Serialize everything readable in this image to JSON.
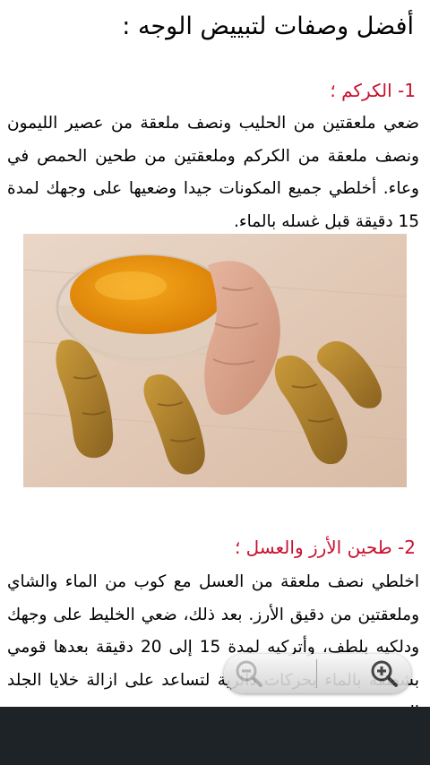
{
  "article": {
    "title": "أفضل وصفات لتبييض الوجه :",
    "recipes": [
      {
        "heading": "1- الكركم ؛",
        "body": "ضعي ملعقتين من الحليب ونصف ملعقة من عصير الليمون ونصف ملعقة من الكركم وملعقتين من طحين الحمص في وعاء. أخلطي جميع المكونات جيدا وضعيها على وجهك لمدة 15 دقيقة قبل غسله بالماء."
      },
      {
        "heading": "2- طحين الأرز والعسل ؛",
        "body": "اخلطي نصف ملعقة من العسل مع كوب من الماء والشاي وملعقتين من دقيق الأرز. بعد ذلك، ضعي الخليط على وجهك ودلكيه بلطف، وأتركيه لمدة 15 إلى 20 دقيقة بعدها قومي بشطفه بالماء بحركات دائرية لتساعد على ازالة خلايا الجلد الميتة"
      }
    ]
  },
  "zoom": {
    "out_icon": "zoom-out-icon",
    "in_icon": "zoom-in-icon"
  },
  "colors": {
    "heading": "#c8102e",
    "bottom_bar": "#1e2328"
  }
}
